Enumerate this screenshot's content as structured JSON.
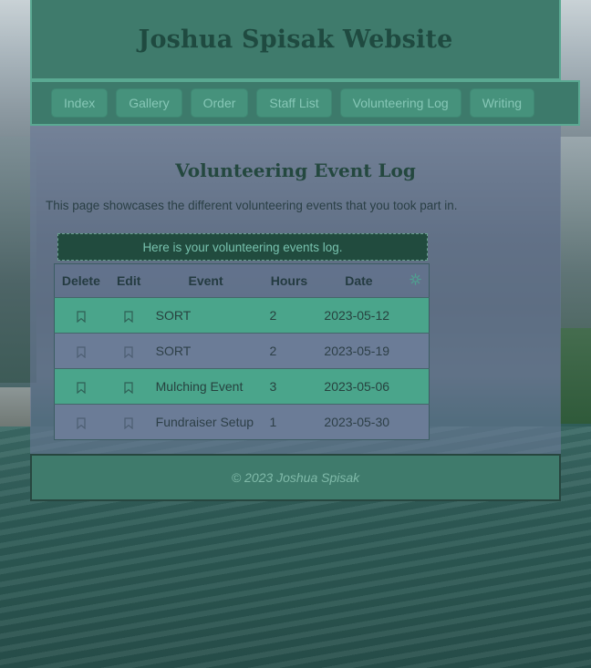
{
  "header": {
    "title": "Joshua Spisak Website"
  },
  "nav": {
    "items": [
      {
        "label": "Index"
      },
      {
        "label": "Gallery"
      },
      {
        "label": "Order"
      },
      {
        "label": "Staff List"
      },
      {
        "label": "Volunteering Log"
      },
      {
        "label": "Writing"
      }
    ]
  },
  "main": {
    "heading": "Volunteering Event Log",
    "intro": "This page showcases the different volunteering events that you took part in.",
    "notice": "Here is your volunteering events log.",
    "table": {
      "columns": {
        "delete": "Delete",
        "edit": "Edit",
        "event": "Event",
        "hours": "Hours",
        "date": "Date"
      },
      "settings_icon": "gear-icon",
      "row_icons": {
        "delete": "bookmark-icon",
        "edit": "bookmark-icon"
      },
      "rows": [
        {
          "event": "SORT",
          "hours": "2",
          "date": "2023-05-12"
        },
        {
          "event": "SORT",
          "hours": "2",
          "date": "2023-05-19"
        },
        {
          "event": "Mulching Event",
          "hours": "3",
          "date": "2023-05-06"
        },
        {
          "event": "Fundraiser Setup",
          "hours": "1",
          "date": "2023-05-30"
        }
      ]
    }
  },
  "footer": {
    "copyright": "© 2023 Joshua Spisak"
  },
  "colors": {
    "header_bg": "#3f7b6c",
    "nav_button_bg": "#46927c",
    "row_highlight": "#4aa58b",
    "row_alt": "#6b7c97"
  }
}
